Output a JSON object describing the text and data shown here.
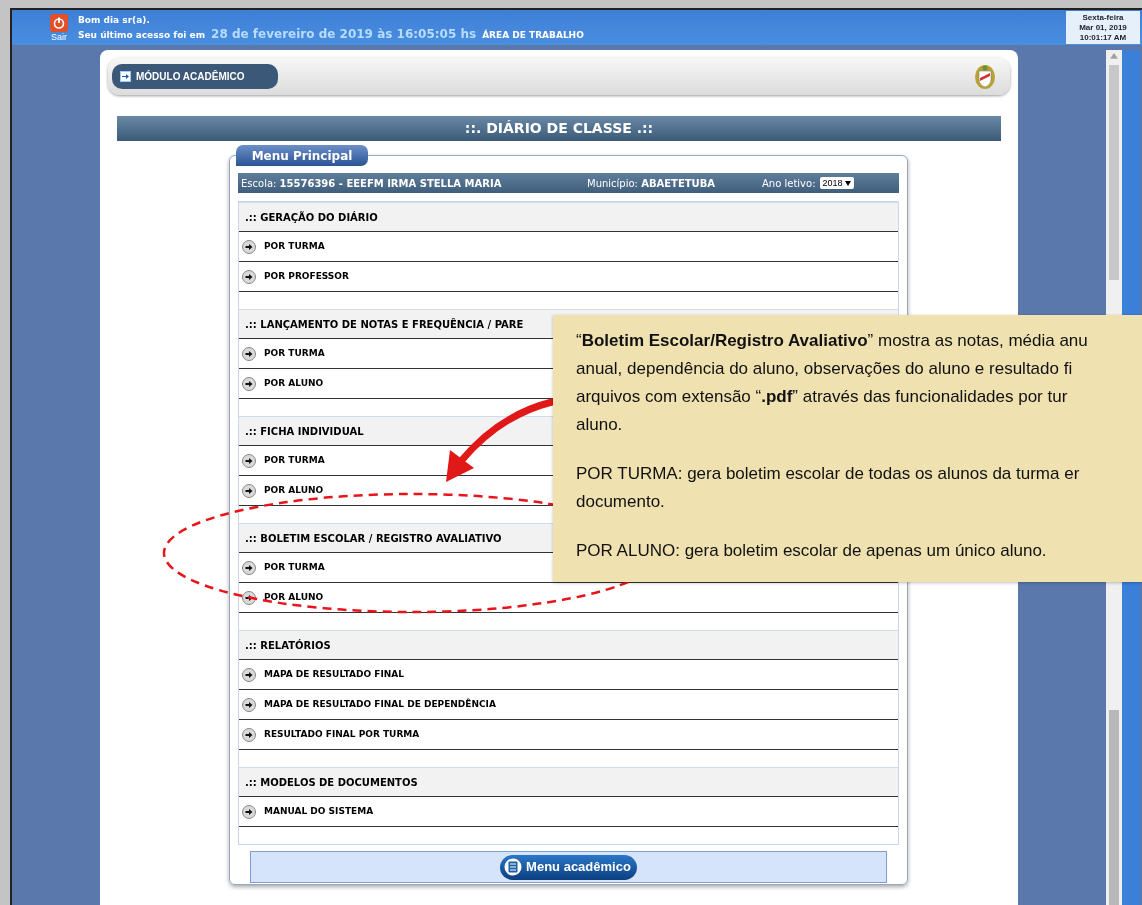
{
  "header": {
    "logout_label": "Sair",
    "greeting": "Bom dia sr(a).",
    "last_access_label": "Seu último acesso foi em",
    "last_access_date": "28 de fevereiro de 2019 às 16:05:05 hs",
    "area_label": "ÁREA DE TRABALHO"
  },
  "clock": [
    "Sexta-feira",
    "Mar 01, 2019",
    "10:01:17 AM"
  ],
  "module_bar": {
    "label": "MÓDULO ACADÊMICO"
  },
  "page_title": "::. DIÁRIO DE CLASSE .::",
  "menu": {
    "tab_label": "Menu Principal",
    "school_label": "Escola:",
    "school_value": "15576396 - EEEFM IRMA STELLA MARIA",
    "municipality_label": "Município:",
    "municipality_value": "ABAETETUBA",
    "year_label": "Ano letivo:",
    "year_value": "2018",
    "sections": [
      {
        "title": ".:: GERAÇÃO DO DIÁRIO",
        "items": [
          "POR TURMA",
          "POR PROFESSOR"
        ]
      },
      {
        "title": ".:: LANÇAMENTO DE NOTAS E FREQUÊNCIA / PARE",
        "items": [
          "POR TURMA",
          "POR ALUNO"
        ]
      },
      {
        "title": ".:: FICHA INDIVIDUAL",
        "items": [
          "POR TURMA",
          "POR ALUNO"
        ]
      },
      {
        "title": ".:: BOLETIM ESCOLAR / REGISTRO AVALIATIVO",
        "items": [
          "POR TURMA",
          "POR ALUNO"
        ]
      },
      {
        "title": ".:: RELATÓRIOS",
        "items": [
          "MAPA DE RESULTADO FINAL",
          "MAPA DE RESULTADO FINAL DE DEPENDÊNCIA",
          "RESULTADO FINAL POR TURMA"
        ]
      },
      {
        "title": ".:: MODELOS DE DOCUMENTOS",
        "items": [
          "MANUAL DO SISTEMA"
        ]
      }
    ],
    "footer_button": "Menu acadêmico"
  },
  "callout": {
    "paragraphs": [
      [
        "“**Boletim Escolar/Registro Avaliativo**” mostra as notas, média anu",
        "anual, dependência do aluno, observações do aluno e resultado fi",
        "arquivos com extensão “**.pdf**” através das funcionalidades por tur",
        "aluno."
      ],
      [
        "POR TURMA: gera boletim escolar de todas os alunos da turma er",
        "documento."
      ],
      [
        "POR ALUNO: gera boletim escolar de apenas um único aluno."
      ]
    ]
  }
}
